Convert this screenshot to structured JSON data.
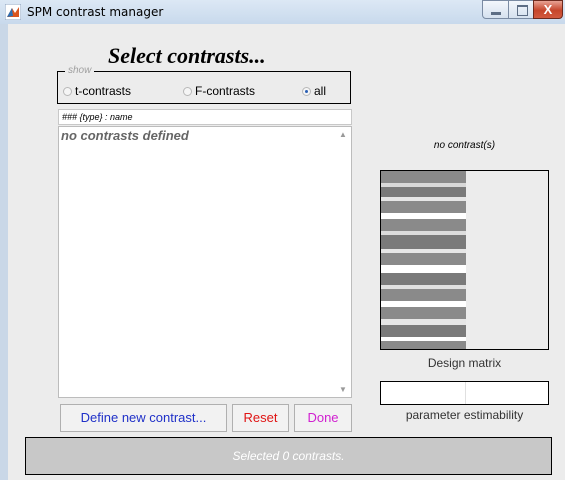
{
  "window": {
    "title": "SPM contrast manager",
    "controls": {
      "minimize": "–",
      "maximize": "□",
      "close": "X"
    }
  },
  "heading": "Select contrasts...",
  "show": {
    "legend": "show",
    "options": [
      {
        "label": "t-contrasts",
        "selected": false
      },
      {
        "label": "F-contrasts",
        "selected": false
      },
      {
        "label": "all",
        "selected": true
      }
    ]
  },
  "list": {
    "header": "### {type} : name",
    "empty_text": "no contrasts defined"
  },
  "buttons": {
    "define": "Define new contrast...",
    "reset": "Reset",
    "done": "Done"
  },
  "design": {
    "caption": "no contrast(s)",
    "matrix_label": "Design matrix",
    "estimability_label": "parameter estimability"
  },
  "status": "Selected 0 contrasts.",
  "colors": {
    "define": "#1f30c8",
    "reset": "#e01414",
    "done": "#d020d0"
  }
}
